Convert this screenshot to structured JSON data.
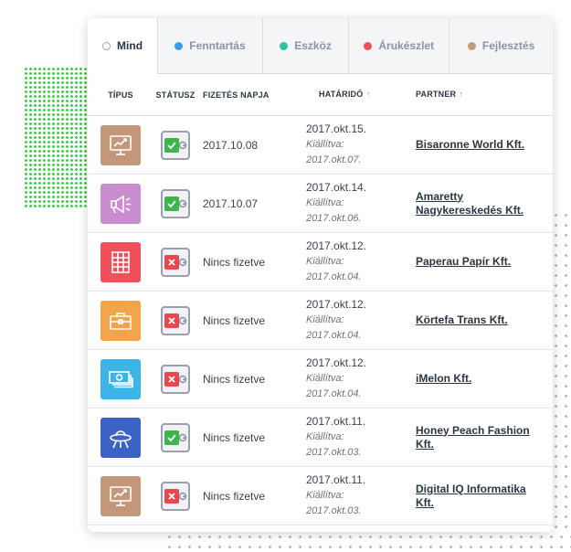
{
  "tabs": [
    {
      "label": "Mind",
      "color": "",
      "active": true
    },
    {
      "label": "Fenntartás",
      "color": "#3b9de8",
      "active": false
    },
    {
      "label": "Eszköz",
      "color": "#2ec4a0",
      "active": false
    },
    {
      "label": "Árukészlet",
      "color": "#f0505a",
      "active": false
    },
    {
      "label": "Fejlesztés",
      "color": "#c49a78",
      "active": false
    }
  ],
  "columns": {
    "type": "TÍPUS",
    "status": "STÁTUSZ",
    "paid": "FIZETÉS NAPJA",
    "due": "HATÁRIDŐ",
    "partner": "PARTNER"
  },
  "issued_label": "Kiállítva:",
  "rows": [
    {
      "type_icon": "presentation-chart-icon",
      "type_color": "#c4977a",
      "status": "paid",
      "paid": "2017.10.08",
      "due": "2017.okt.15.",
      "issued": "2017.okt.07.",
      "partner": "Bisaronne World Kft."
    },
    {
      "type_icon": "megaphone-icon",
      "type_color": "#c98dd0",
      "status": "paid",
      "paid": "2017.10.07",
      "due": "2017.okt.14.",
      "issued": "2017.okt.06.",
      "partner": "Amaretty Nagykereskedés Kft."
    },
    {
      "type_icon": "grid-shelf-icon",
      "type_color": "#f0505a",
      "status": "unpaid",
      "paid": "Nincs fizetve",
      "due": "2017.okt.12.",
      "issued": "2017.okt.04.",
      "partner": "Paperau Papír Kft."
    },
    {
      "type_icon": "briefcase-icon",
      "type_color": "#f2a44a",
      "status": "unpaid",
      "paid": "Nincs fizetve",
      "due": "2017.okt.12.",
      "issued": "2017.okt.04.",
      "partner": "Körtefa Trans Kft."
    },
    {
      "type_icon": "money-stack-icon",
      "type_color": "#3db4e6",
      "status": "unpaid",
      "paid": "Nincs fizetve",
      "due": "2017.okt.12.",
      "issued": "2017.okt.04.",
      "partner": "iMelon Kft."
    },
    {
      "type_icon": "ufo-icon",
      "type_color": "#3b63c4",
      "status": "paid",
      "paid": "Nincs fizetve",
      "due": "2017.okt.11.",
      "issued": "2017.okt.03.",
      "partner": "Honey Peach Fashion Kft."
    },
    {
      "type_icon": "presentation-chart-icon",
      "type_color": "#c4977a",
      "status": "unpaid",
      "paid": "Nincs fizetve",
      "due": "2017.okt.11.",
      "issued": "2017.okt.03.",
      "partner": "Digital IQ Informatika Kft."
    }
  ],
  "status_colors": {
    "paid": "#3cb54a",
    "unpaid": "#e8474f"
  }
}
